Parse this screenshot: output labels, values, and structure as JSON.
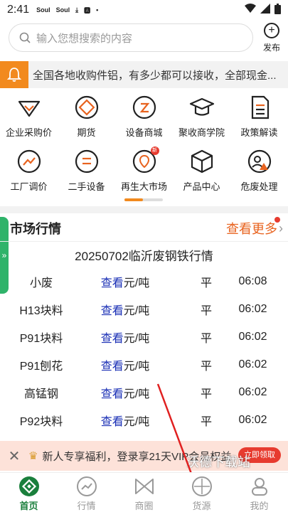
{
  "status": {
    "time": "2:41",
    "icons": [
      "Soul",
      "Soul"
    ]
  },
  "search": {
    "placeholder": "输入您想搜索的内容"
  },
  "publish": {
    "label": "发布"
  },
  "notice": {
    "text": "全国各地收购件铝，有多少都可以接收，全部现金..."
  },
  "grid": [
    {
      "label": "企业采购价",
      "icon": "enterprise-price-icon"
    },
    {
      "label": "期货",
      "icon": "futures-icon"
    },
    {
      "label": "设备商城",
      "icon": "equipment-mall-icon"
    },
    {
      "label": "聚收商学院",
      "icon": "academy-icon"
    },
    {
      "label": "政策解读",
      "icon": "policy-icon"
    },
    {
      "label": "工厂调价",
      "icon": "factory-price-icon"
    },
    {
      "label": "二手设备",
      "icon": "secondhand-icon"
    },
    {
      "label": "再生大市场",
      "icon": "recycle-market-icon",
      "badge": "新"
    },
    {
      "label": "产品中心",
      "icon": "product-center-icon"
    },
    {
      "label": "危废处理",
      "icon": "hazard-waste-icon"
    }
  ],
  "market": {
    "title": "市场行情",
    "more": "查看更多",
    "report_title": "20250702临沂废钢铁行情",
    "view_label": "查看",
    "unit": "元/吨",
    "rows": [
      {
        "name": "小废",
        "trend": "平",
        "time": "06:08"
      },
      {
        "name": "H13块料",
        "trend": "平",
        "time": "06:02"
      },
      {
        "name": "P91块料",
        "trend": "平",
        "time": "06:02"
      },
      {
        "name": "P91刨花",
        "trend": "平",
        "time": "06:02"
      },
      {
        "name": "高锰钢",
        "trend": "平",
        "time": "06:02"
      },
      {
        "name": "P92块料",
        "trend": "平",
        "time": "06:02"
      }
    ]
  },
  "promo": {
    "text": "新人专享福利，登录享21天VIP会员权益",
    "button": "立即领取",
    "watermark": "沃德下载站"
  },
  "nav": [
    {
      "label": "首页",
      "icon": "home-icon",
      "active": true
    },
    {
      "label": "行情",
      "icon": "chart-icon"
    },
    {
      "label": "商圈",
      "icon": "business-circle-icon"
    },
    {
      "label": "货源",
      "icon": "supply-icon"
    },
    {
      "label": "我的",
      "icon": "profile-icon"
    }
  ],
  "colors": {
    "accent": "#f28a1e",
    "green": "#2fb36a",
    "link": "#1a2fb5",
    "more": "#e8631f"
  }
}
